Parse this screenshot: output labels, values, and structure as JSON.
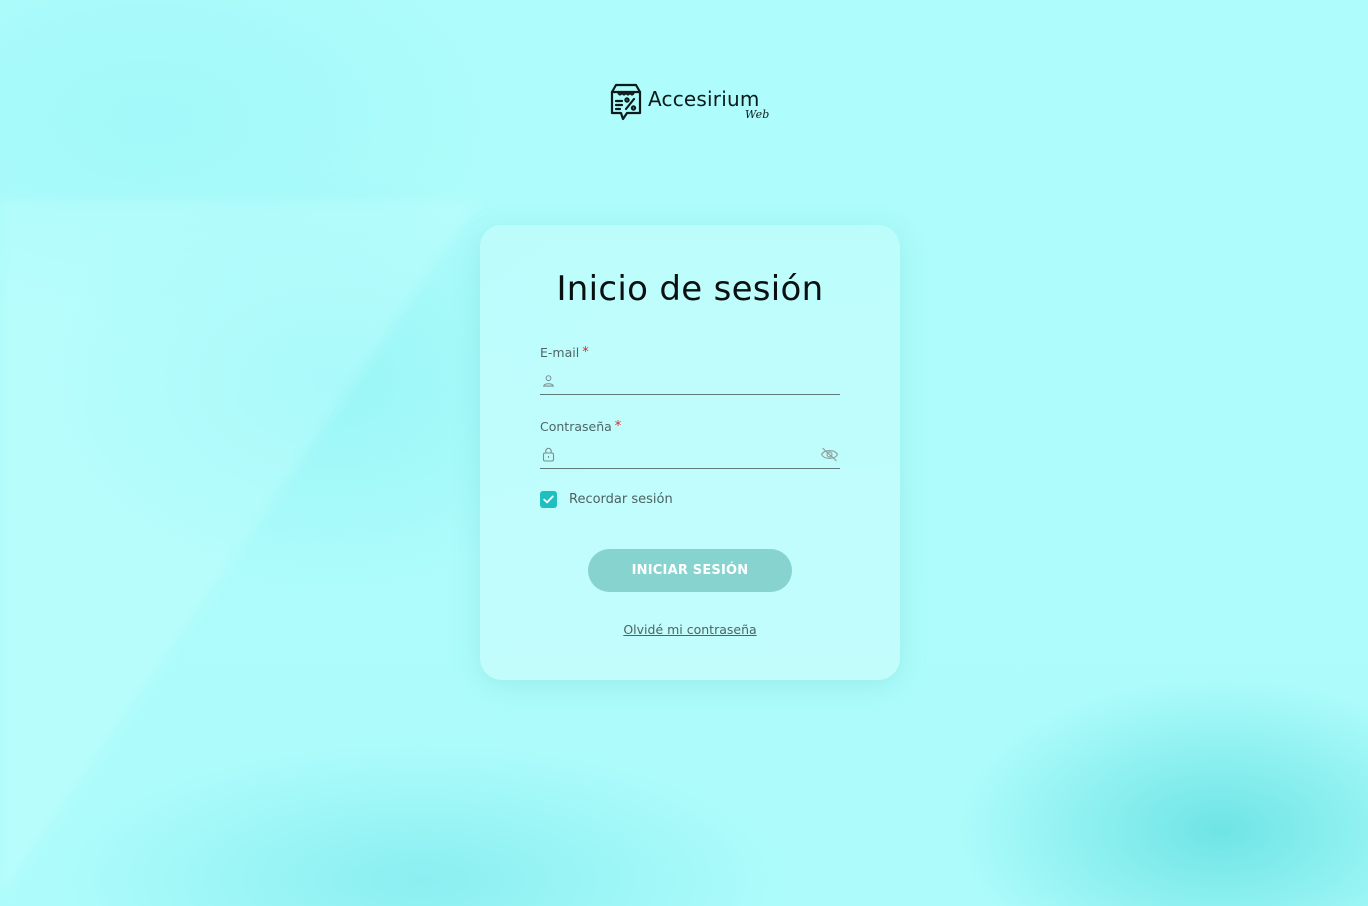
{
  "brand": {
    "name": "Accesirium",
    "sub": "Web",
    "logo_icon": "store-discount-icon"
  },
  "login": {
    "title": "Inicio de sesión",
    "email": {
      "label": "E-mail",
      "required_mark": "*",
      "value": "",
      "icon": "user-icon"
    },
    "password": {
      "label": "Contraseña",
      "required_mark": "*",
      "value": "",
      "icon": "lock-icon",
      "toggle_icon": "eye-off-icon"
    },
    "remember": {
      "label": "Recordar sesión",
      "checked": true
    },
    "submit_label": "INICIAR SESIÓN",
    "forgot_label": "Olvidé mi contraseña"
  },
  "colors": {
    "background": "#aefcfb",
    "accent": "#1fbfbf",
    "button": "#87d3cf",
    "required": "#e02424"
  }
}
